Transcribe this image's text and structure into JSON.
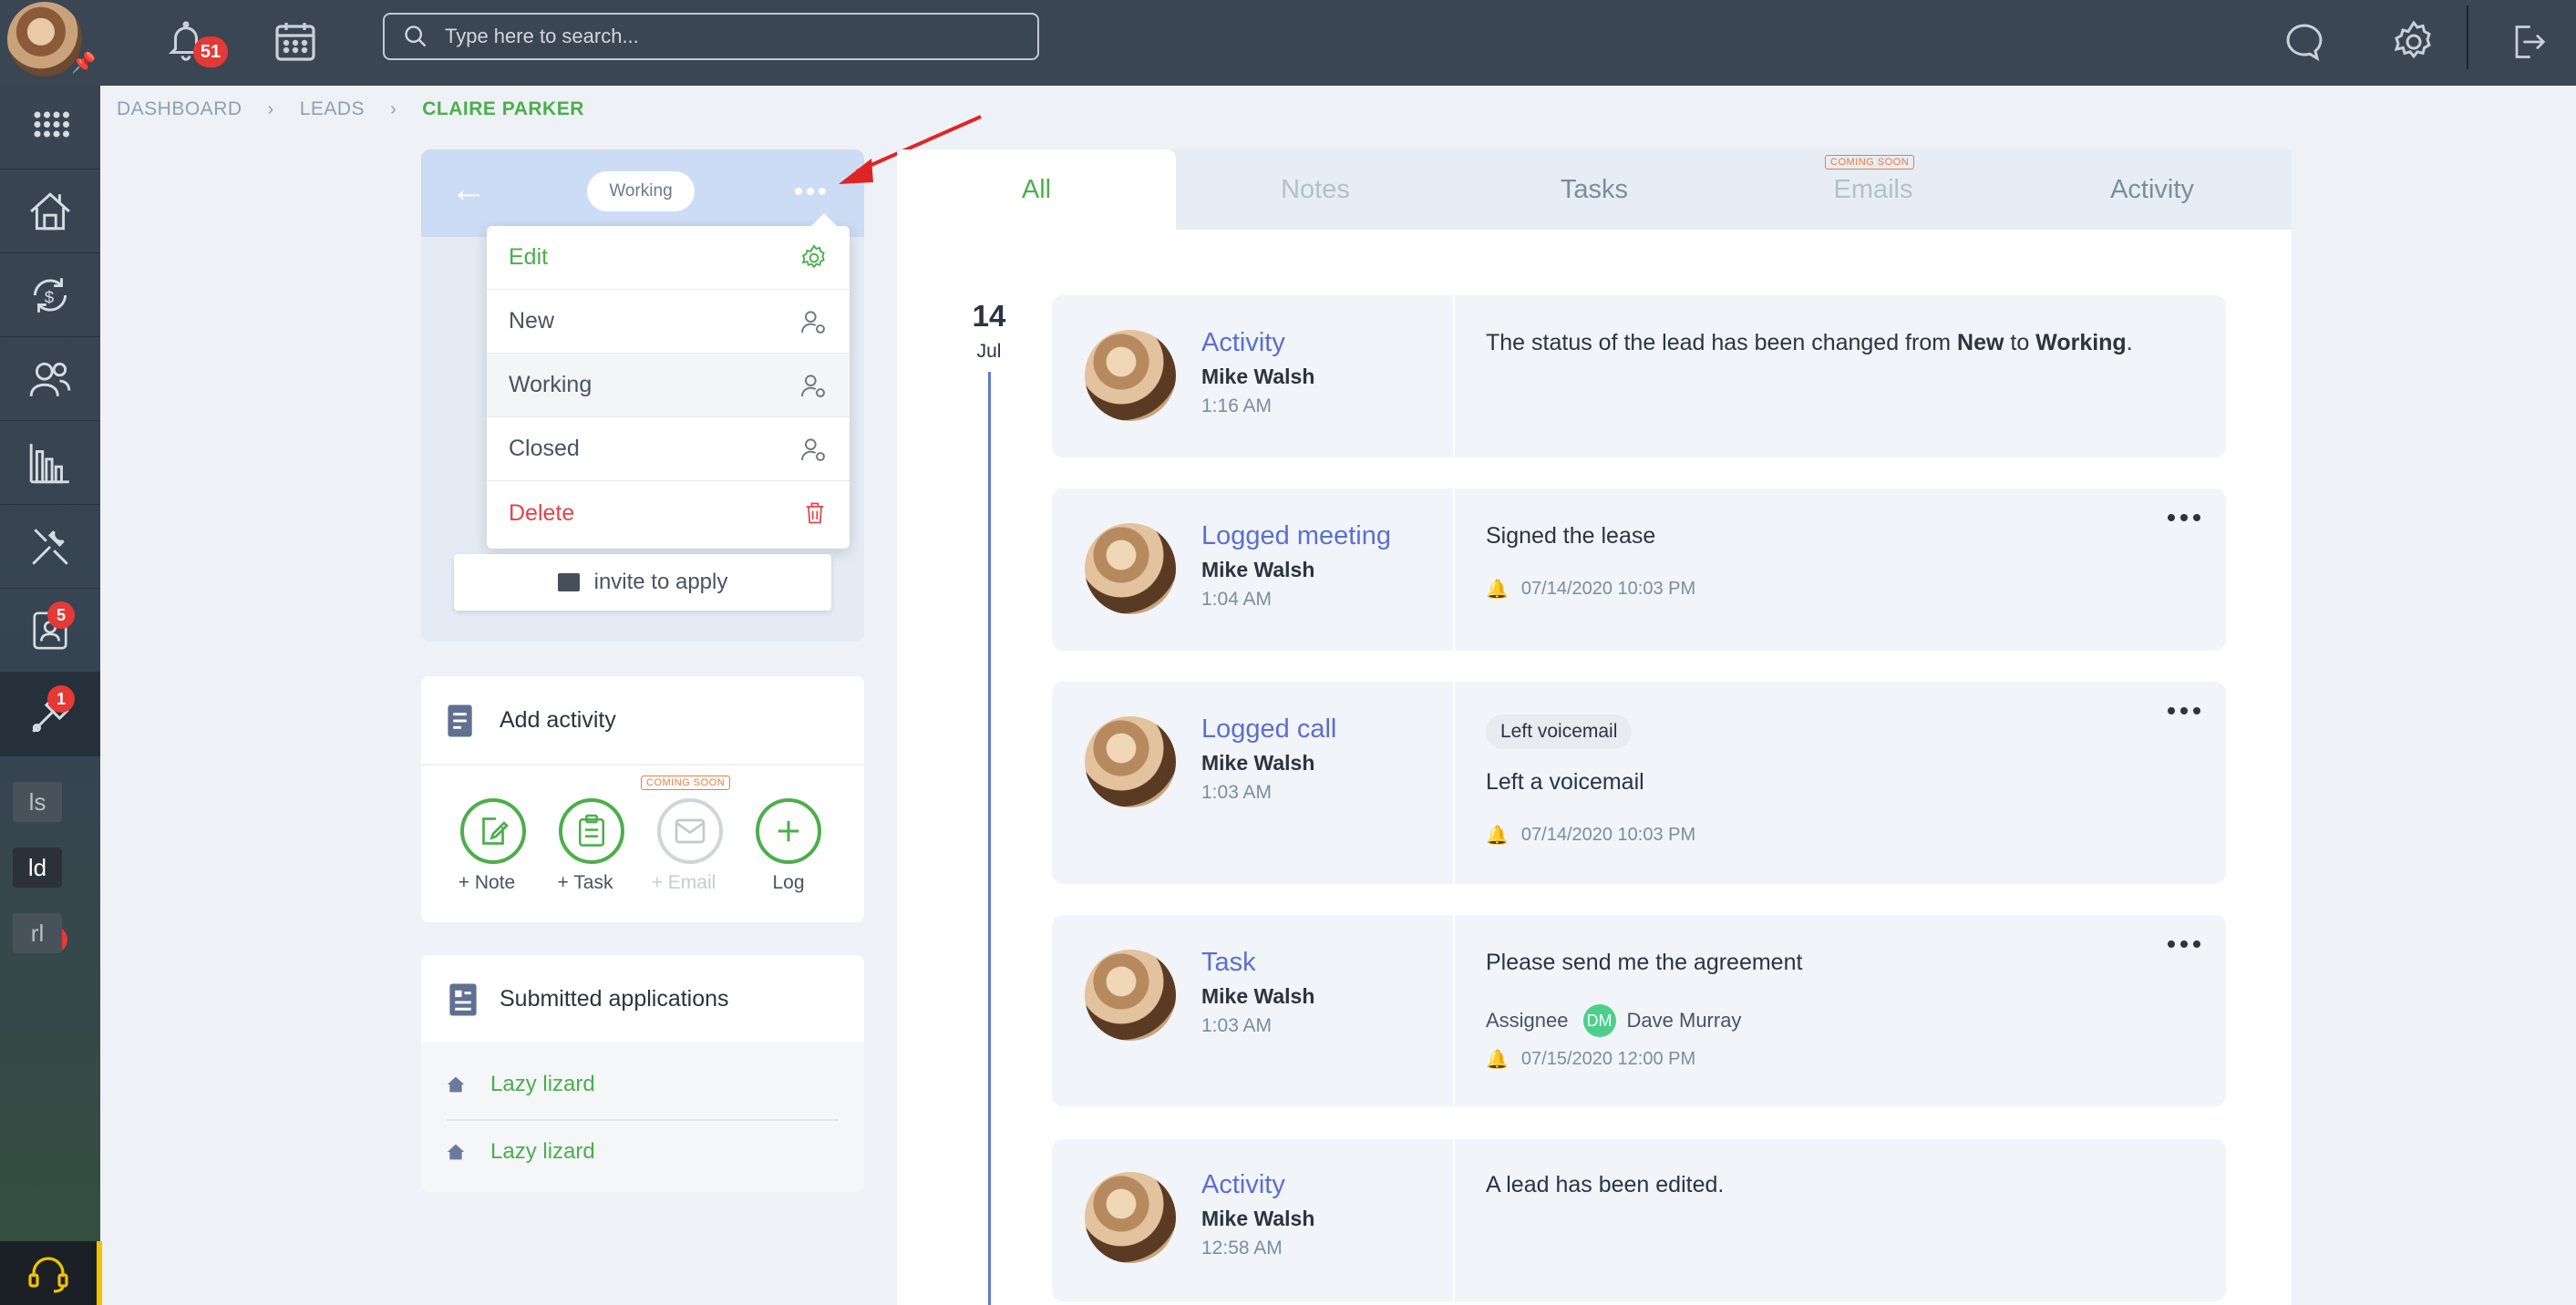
{
  "topbar": {
    "notifications_count": "51",
    "search_placeholder": "Type here to search..."
  },
  "sidebar": {
    "badges": {
      "contacts": "5",
      "tools": "1",
      "ld": "1"
    },
    "shortcuts": [
      "ls",
      "ld",
      "rl"
    ]
  },
  "breadcrumb": {
    "items": [
      "DASHBOARD",
      "LEADS",
      "CLAIRE PARKER"
    ]
  },
  "lead": {
    "status": "Working",
    "menu": {
      "items": [
        {
          "label": "Edit",
          "icon": "gear-icon"
        },
        {
          "label": "New",
          "icon": "user-status-icon"
        },
        {
          "label": "Working",
          "icon": "user-status-icon"
        },
        {
          "label": "Closed",
          "icon": "user-status-icon"
        },
        {
          "label": "Delete",
          "icon": "trash-icon"
        }
      ]
    },
    "invite_label": "invite to apply"
  },
  "add_activity": {
    "title": "Add activity",
    "coming_soon": "COMING SOON",
    "actions": [
      "+ Note",
      "+ Task",
      "+ Email",
      "Log"
    ]
  },
  "applications": {
    "title": "Submitted applications",
    "items": [
      "Lazy lizard",
      "Lazy lizard"
    ]
  },
  "tabs": {
    "items": [
      "All",
      "Notes",
      "Tasks",
      "Emails",
      "Activity"
    ],
    "coming_soon": "COMING SOON"
  },
  "timeline": {
    "day": "14",
    "month": "Jul",
    "entries": [
      {
        "type": "Activity",
        "author": "Mike Walsh",
        "time": "1:16 AM",
        "text_pre": "The status of the lead has been changed from ",
        "from": "New",
        "text_mid": " to ",
        "to": "Working",
        "text_post": "."
      },
      {
        "type": "Logged meeting",
        "author": "Mike Walsh",
        "time": "1:04 AM",
        "text": "Signed the lease",
        "reminder": "07/14/2020 10:03 PM"
      },
      {
        "type": "Logged call",
        "author": "Mike Walsh",
        "time": "1:03 AM",
        "tag": "Left voicemail",
        "text": "Left a voicemail",
        "reminder": "07/14/2020 10:03 PM"
      },
      {
        "type": "Task",
        "author": "Mike Walsh",
        "time": "1:03 AM",
        "text": "Please send me the agreement",
        "assignee_label": "Assignee",
        "assignee_initials": "DM",
        "assignee_name": "Dave Murray",
        "reminder": "07/15/2020 12:00 PM"
      },
      {
        "type": "Activity",
        "author": "Mike Walsh",
        "time": "12:58 AM",
        "text": "A lead has been edited."
      }
    ]
  },
  "colors": {
    "topbar": "#3a4651",
    "accent_green": "#4cae4c",
    "link_blue": "#5c6fd0",
    "danger": "#e0454a",
    "badge": "#e53935"
  }
}
